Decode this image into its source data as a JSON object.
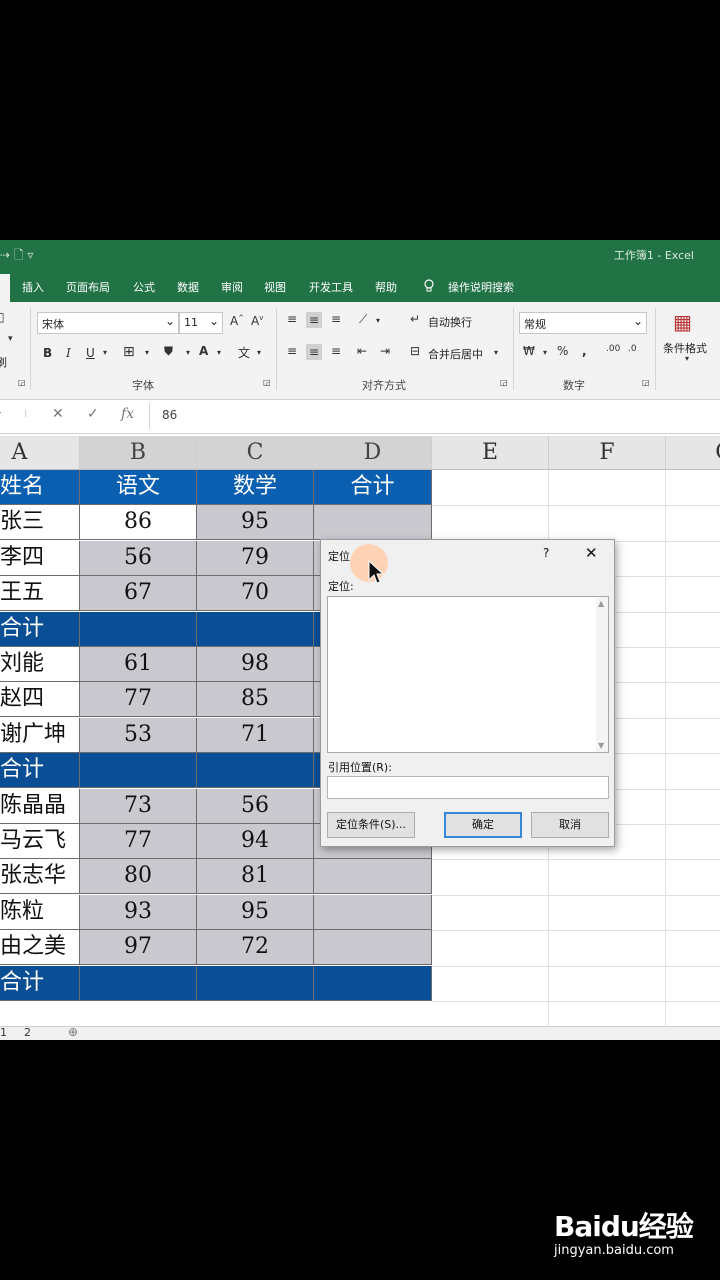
{
  "titlebar": {
    "quick_access": "⇢  🗋  ▿",
    "title": "工作簿1  -  Excel"
  },
  "ribbon_tabs": [
    "插入",
    "页面布局",
    "公式",
    "数据",
    "审阅",
    "视图",
    "开发工具",
    "帮助",
    "操作说明搜索"
  ],
  "ribbon": {
    "clipboard_partial": "刷",
    "font_name": "宋体",
    "font_size": "11",
    "font_group_label": "字体",
    "wrap_text": "自动换行",
    "merge_center": "合并后居中",
    "align_group_label": "对齐方式",
    "number_format": "常规",
    "number_group_label": "数字",
    "conditional_format": "条件格式",
    "bold": "B",
    "italic": "I",
    "underline": "U"
  },
  "formula_bar": {
    "cancel": "✕",
    "enter": "✓",
    "fx": "fx",
    "value": "86"
  },
  "columns": [
    "A",
    "B",
    "C",
    "D",
    "E",
    "F",
    "G"
  ],
  "table": {
    "header": [
      "姓名",
      "语文",
      "数学",
      "合计"
    ],
    "rows": [
      {
        "name": "张三",
        "yuwen": "86",
        "shuxue": "95"
      },
      {
        "name": "李四",
        "yuwen": "56",
        "shuxue": "79"
      },
      {
        "name": "王五",
        "yuwen": "67",
        "shuxue": "70"
      },
      {
        "name": "合计",
        "subtotal": true
      },
      {
        "name": "刘能",
        "yuwen": "61",
        "shuxue": "98"
      },
      {
        "name": "赵四",
        "yuwen": "77",
        "shuxue": "85"
      },
      {
        "name": "谢广坤",
        "yuwen": "53",
        "shuxue": "71"
      },
      {
        "name": "合计",
        "subtotal": true
      },
      {
        "name": "陈晶晶",
        "yuwen": "73",
        "shuxue": "56"
      },
      {
        "name": "马云飞",
        "yuwen": "77",
        "shuxue": "94"
      },
      {
        "name": "张志华",
        "yuwen": "80",
        "shuxue": "81"
      },
      {
        "name": "陈粒",
        "yuwen": "93",
        "shuxue": "95"
      },
      {
        "name": "由之美",
        "yuwen": "97",
        "shuxue": "72"
      },
      {
        "name": "合计",
        "subtotal": true
      }
    ]
  },
  "sheet_tabs": [
    "1",
    "2"
  ],
  "dialog": {
    "title": "定位",
    "help": "?",
    "close": "✕",
    "goto_label": "定位:",
    "reference_label": "引用位置(R):",
    "special_button": "定位条件(S)...",
    "ok_button": "确定",
    "cancel_button": "取消"
  },
  "watermark": {
    "brand": "Baidu经验",
    "url": "jingyan.baidu.com"
  },
  "colors": {
    "excel_green": "#217346",
    "header_blue": "#0a5fb0",
    "subtotal_blue": "#0a4f96",
    "selection_gray": "#c9c9cf"
  }
}
